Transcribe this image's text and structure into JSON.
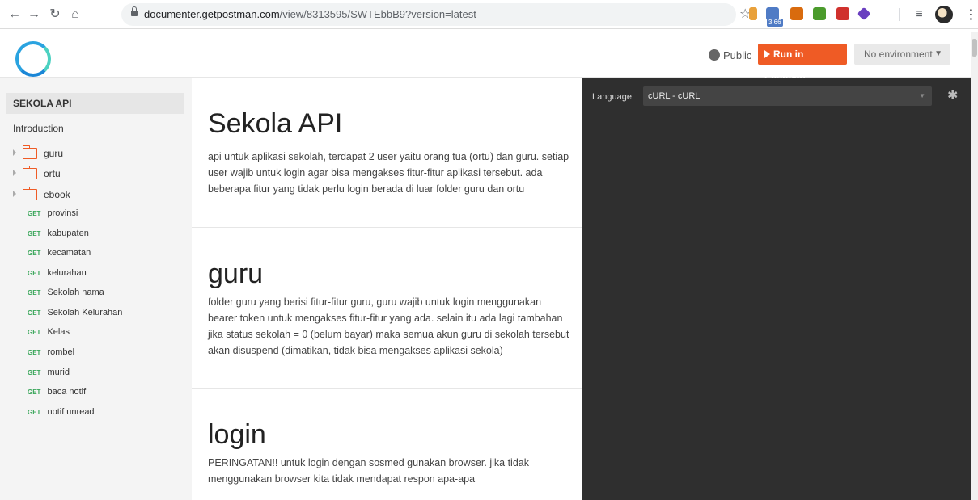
{
  "browser": {
    "url_host": "documenter.getpostman.com",
    "url_path": "/view/8313595/SWTEbbB9?version=latest",
    "badge": "3.66",
    "back_icon": "arrow-left-icon",
    "forward_icon": "arrow-right-icon",
    "reload_icon": "reload-icon",
    "home_icon": "home-icon",
    "star_icon": "star-icon",
    "menu_icon": "kebab-icon",
    "ext_colors": [
      "#e9a13b",
      "#4f7bc5",
      "#d96b0e",
      "#4b9b2c",
      "#d0312d",
      "#6a3fc0"
    ]
  },
  "topbar": {
    "public_label": "Public",
    "run_label": "Run in Postman",
    "env_label": "No environment",
    "colors": {
      "run": "#ef5b25",
      "logo": "#2aa3e0"
    }
  },
  "sidebar": {
    "collection": "SEKOLA API",
    "intro": "Introduction",
    "folders": [
      "guru",
      "ortu",
      "ebook"
    ],
    "requests": [
      {
        "method": "GET",
        "name": "provinsi"
      },
      {
        "method": "GET",
        "name": "kabupaten"
      },
      {
        "method": "GET",
        "name": "kecamatan"
      },
      {
        "method": "GET",
        "name": "kelurahan"
      },
      {
        "method": "GET",
        "name": "Sekolah nama"
      },
      {
        "method": "GET",
        "name": "Sekolah Kelurahan"
      },
      {
        "method": "GET",
        "name": "Kelas"
      },
      {
        "method": "GET",
        "name": "rombel"
      },
      {
        "method": "GET",
        "name": "murid"
      },
      {
        "method": "GET",
        "name": "baca notif"
      },
      {
        "method": "GET",
        "name": "notif unread"
      }
    ]
  },
  "content": {
    "sections": [
      {
        "title": "Sekola API",
        "body": "api untuk aplikasi sekolah, terdapat 2 user yaitu orang tua (ortu) dan guru. setiap user wajib untuk login agar bisa mengakses fitur-fitur aplikasi tersebut. ada beberapa fitur yang tidak perlu login berada di luar folder guru dan ortu"
      },
      {
        "title": "guru",
        "body": "folder guru yang berisi fitur-fitur guru, guru wajib untuk login menggunakan bearer token untuk mengakses fitur-fitur yang ada. selain itu ada lagi tambahan jika status sekolah = 0 (belum bayar) maka semua akun guru di sekolah tersebut akan disuspend (dimatikan, tidak bisa mengakses aplikasi sekola)"
      },
      {
        "title": "login",
        "body": "PERINGATAN!! untuk login dengan sosmed gunakan browser. jika tidak menggunakan browser kita tidak mendapat respon apa-apa"
      }
    ]
  },
  "panel": {
    "language_label": "Language",
    "language_value": "cURL - cURL",
    "gear_icon": "gear-icon"
  }
}
